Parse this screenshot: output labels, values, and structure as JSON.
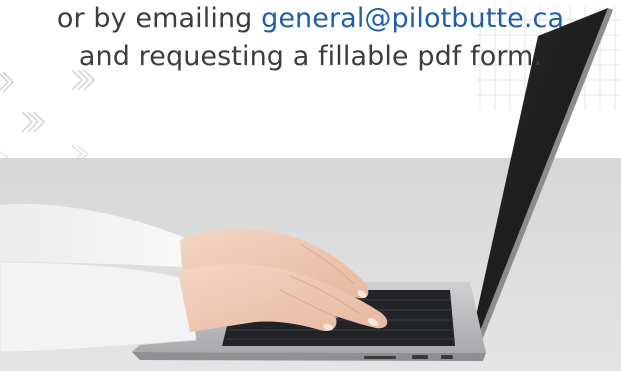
{
  "info": {
    "line1_prefix": "or by emailing ",
    "email": "general@pilotbutte.ca",
    "line2": "and requesting a fillable pdf form."
  },
  "colors": {
    "body_text": "#3d3d3d",
    "link": "#1f5fa8",
    "band": "#d9d9d9",
    "screen": "#1c1c1c"
  },
  "image": {
    "subject": "hands typing on a laptop"
  }
}
